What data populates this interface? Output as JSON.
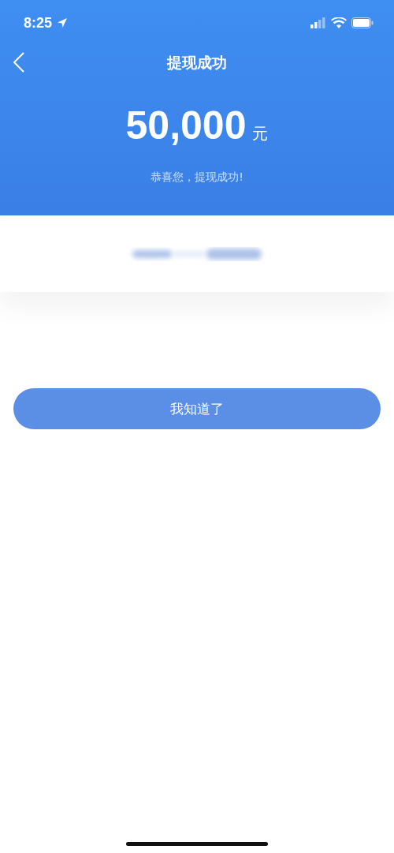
{
  "status_bar": {
    "time": "8:25"
  },
  "header": {
    "title": "提现成功",
    "amount": "50,000",
    "unit": "元",
    "message": "恭喜您，提现成功!"
  },
  "card": {
    "kind": "redacted"
  },
  "button": {
    "label": "我知道了"
  }
}
